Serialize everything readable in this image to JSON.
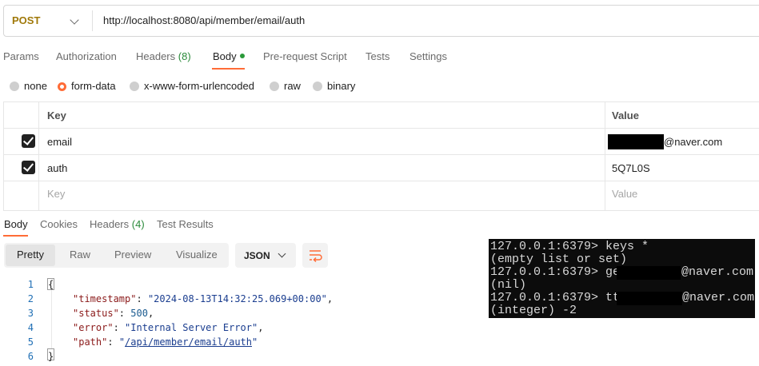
{
  "request": {
    "method": "POST",
    "url": "http://localhost:8080/api/member/email/auth"
  },
  "request_tabs": {
    "params": "Params",
    "authorization": "Authorization",
    "headers": "Headers",
    "headers_count": "(8)",
    "body": "Body",
    "pre_request": "Pre-request Script",
    "tests": "Tests",
    "settings": "Settings"
  },
  "body_types": {
    "none": "none",
    "form_data": "form-data",
    "urlencoded": "x-www-form-urlencoded",
    "raw": "raw",
    "binary": "binary",
    "selected": "form-data"
  },
  "form_table": {
    "key_header": "Key",
    "value_header": "Value",
    "rows": [
      {
        "key": "email",
        "value": "@naver.com",
        "checked": true
      },
      {
        "key": "auth",
        "value": "5Q7L0S",
        "checked": true
      }
    ],
    "key_placeholder": "Key",
    "value_placeholder": "Value"
  },
  "response_tabs": {
    "body": "Body",
    "cookies": "Cookies",
    "headers": "Headers",
    "headers_count": "(4)",
    "test_results": "Test Results"
  },
  "view_modes": {
    "pretty": "Pretty",
    "raw": "Raw",
    "preview": "Preview",
    "visualize": "Visualize",
    "format": "JSON"
  },
  "response_json": {
    "line_numbers": [
      "1",
      "2",
      "3",
      "4",
      "5",
      "6"
    ],
    "open_brace": "{",
    "close_brace": "}",
    "timestamp_key": "\"timestamp\"",
    "timestamp_value": "\"2024-08-13T14:32:25.069+00:00\"",
    "status_key": "\"status\"",
    "status_value": "500",
    "error_key": "\"error\"",
    "error_value": "\"Internal Server Error\"",
    "path_key": "\"path\"",
    "path_value": "/api/member/email/auth"
  },
  "terminal": {
    "lines": [
      "127.0.0.1:6379> keys *",
      "(empty list or set)",
      "127.0.0.1:6379> get ",
      "(nil)",
      "127.0.0.1:6379> ttl ",
      "(integer) -2"
    ],
    "redacted_suffix": "@naver.com"
  },
  "colors": {
    "accent": "#ff6c37",
    "method": "#a0790a",
    "count_green": "#2a8a3a"
  }
}
